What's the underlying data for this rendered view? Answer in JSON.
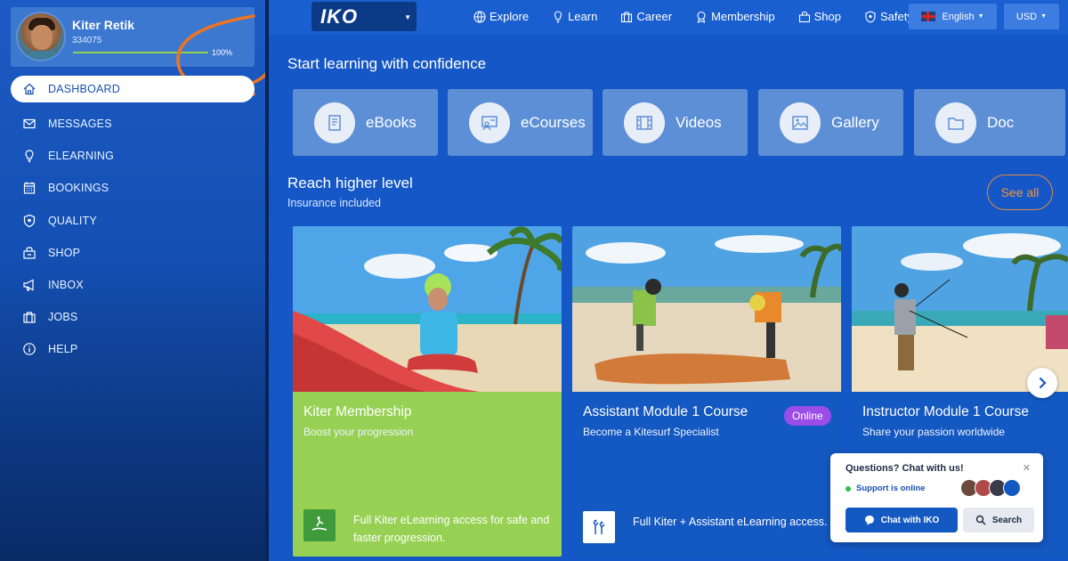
{
  "profile": {
    "name": "Kiter Retik",
    "id": "334075",
    "progress_pct": 100,
    "progress_label": "100%"
  },
  "sidebar": {
    "items": [
      {
        "label": "DASHBOARD",
        "icon": "home-icon",
        "active": true
      },
      {
        "label": "MESSAGES",
        "icon": "envelope-icon"
      },
      {
        "label": "ELEARNING",
        "icon": "lightbulb-icon"
      },
      {
        "label": "BOOKINGS",
        "icon": "calendar-icon"
      },
      {
        "label": "QUALITY",
        "icon": "shield-icon"
      },
      {
        "label": "SHOP",
        "icon": "shop-icon"
      },
      {
        "label": "INBOX",
        "icon": "megaphone-icon"
      },
      {
        "label": "JOBS",
        "icon": "briefcase-icon"
      },
      {
        "label": "HELP",
        "icon": "info-icon"
      }
    ]
  },
  "topbar": {
    "logo": "IKO",
    "nav": [
      {
        "label": "Explore",
        "icon": "globe-icon"
      },
      {
        "label": "Learn",
        "icon": "lightbulb-icon"
      },
      {
        "label": "Career",
        "icon": "briefcase-icon"
      },
      {
        "label": "Membership",
        "icon": "award-icon"
      },
      {
        "label": "Shop",
        "icon": "shop-icon"
      },
      {
        "label": "Safety",
        "icon": "shield-icon"
      }
    ],
    "language": "English",
    "currency": "USD"
  },
  "learning": {
    "title": "Start learning with confidence",
    "resources": [
      {
        "label": "eBooks",
        "icon": "book-icon"
      },
      {
        "label": "eCourses",
        "icon": "presentation-icon"
      },
      {
        "label": "Videos",
        "icon": "film-icon"
      },
      {
        "label": "Gallery",
        "icon": "image-icon"
      },
      {
        "label": "Doc",
        "icon": "folder-icon"
      }
    ]
  },
  "courses": {
    "title": "Reach higher level",
    "subtitle": "Insurance included",
    "see_all": "See all",
    "cards": [
      {
        "title": "Kiter Membership",
        "subtitle": "Boost your progression",
        "description": "Full Kiter eLearning access for safe and faster progression.",
        "color": "#96d154",
        "badge_icon": "kiter-icon"
      },
      {
        "title": "Assistant Module 1 Course",
        "subtitle": "Become a Kitesurf Specialist",
        "description": "Full Kiter + Assistant eLearning access.",
        "color": "#1458c2",
        "pill": "Online",
        "badge_icon": "assistant-icon"
      },
      {
        "title": "Instructor Module 1 Course",
        "subtitle": "Share your passion worldwide",
        "description": "",
        "color": "#1458c2"
      }
    ]
  },
  "chat": {
    "title": "Questions? Chat with us!",
    "status": "Support is online",
    "chat_button": "Chat with IKO",
    "search_button": "Search"
  },
  "colors": {
    "brand_blue": "#1557c6",
    "accent_orange": "#f19347",
    "kiter_green": "#96d154",
    "online_purple": "#9b4de8"
  }
}
